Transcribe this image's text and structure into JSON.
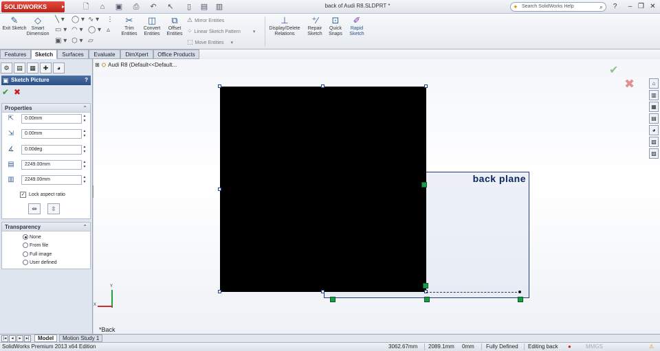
{
  "app": {
    "logo_text": "SOLIDWORKS",
    "doc_title": "back of Audi R8.SLDPRT *",
    "search_placeholder": "Search SolidWorks Help"
  },
  "command_manager": {
    "big_buttons": [
      {
        "label": "Exit Sketch",
        "icon": "exit-sketch-icon"
      },
      {
        "label": "Smart Dimension",
        "icon": "smart-dimension-icon"
      },
      {
        "label": "Trim Entities",
        "icon": "trim-icon"
      },
      {
        "label": "Convert Entities",
        "icon": "convert-icon"
      },
      {
        "label": "Offset Entities",
        "icon": "offset-icon"
      },
      {
        "label": "Display/Delete Relations",
        "icon": "relations-icon"
      },
      {
        "label": "Repair Sketch",
        "icon": "repair-icon"
      },
      {
        "label": "Quick Snaps",
        "icon": "snaps-icon"
      },
      {
        "label": "Rapid Sketch",
        "icon": "rapid-sketch-icon"
      }
    ],
    "small_buttons": [
      {
        "label": "Mirror Entities"
      },
      {
        "label": "Linear Sketch Pattern"
      },
      {
        "label": "Move Entities"
      }
    ]
  },
  "tabs": [
    "Features",
    "Sketch",
    "Surfaces",
    "Evaluate",
    "DimXpert",
    "Office Products"
  ],
  "active_tab": "Sketch",
  "property_manager": {
    "title": "Sketch Picture",
    "help": "?",
    "properties": {
      "header": "Properties",
      "x_origin": "0.00mm",
      "y_origin": "0.00mm",
      "angle": "0.00deg",
      "width": "2249.00mm",
      "height": "2249.00mm",
      "lock_aspect_label": "Lock aspect ratio",
      "lock_aspect_checked": true
    },
    "transparency": {
      "header": "Transparency",
      "options": [
        "None",
        "From file",
        "Full image",
        "User defined"
      ],
      "selected": "None"
    }
  },
  "viewport": {
    "tree_label": "Audi R8  (Default<<Default...",
    "plane_label": "back plane",
    "view_name": "*Back",
    "axis_y": "Y",
    "axis_x": "X"
  },
  "bottom_tabs": [
    "Model",
    "Motion Study 1"
  ],
  "status": {
    "edition": "SolidWorks Premium 2013 x64 Edition",
    "x": "3062.67mm",
    "y": "2089.1mm",
    "z": "0mm",
    "state": "Fully Defined",
    "editing": "Editing back",
    "units": "MMGS"
  },
  "colors": {
    "plane_border": "#213c73",
    "plane_label": "#0d2660",
    "relation_marker": "#1c9a4a",
    "ok": "#2a9a2a",
    "cancel": "#c82020"
  }
}
